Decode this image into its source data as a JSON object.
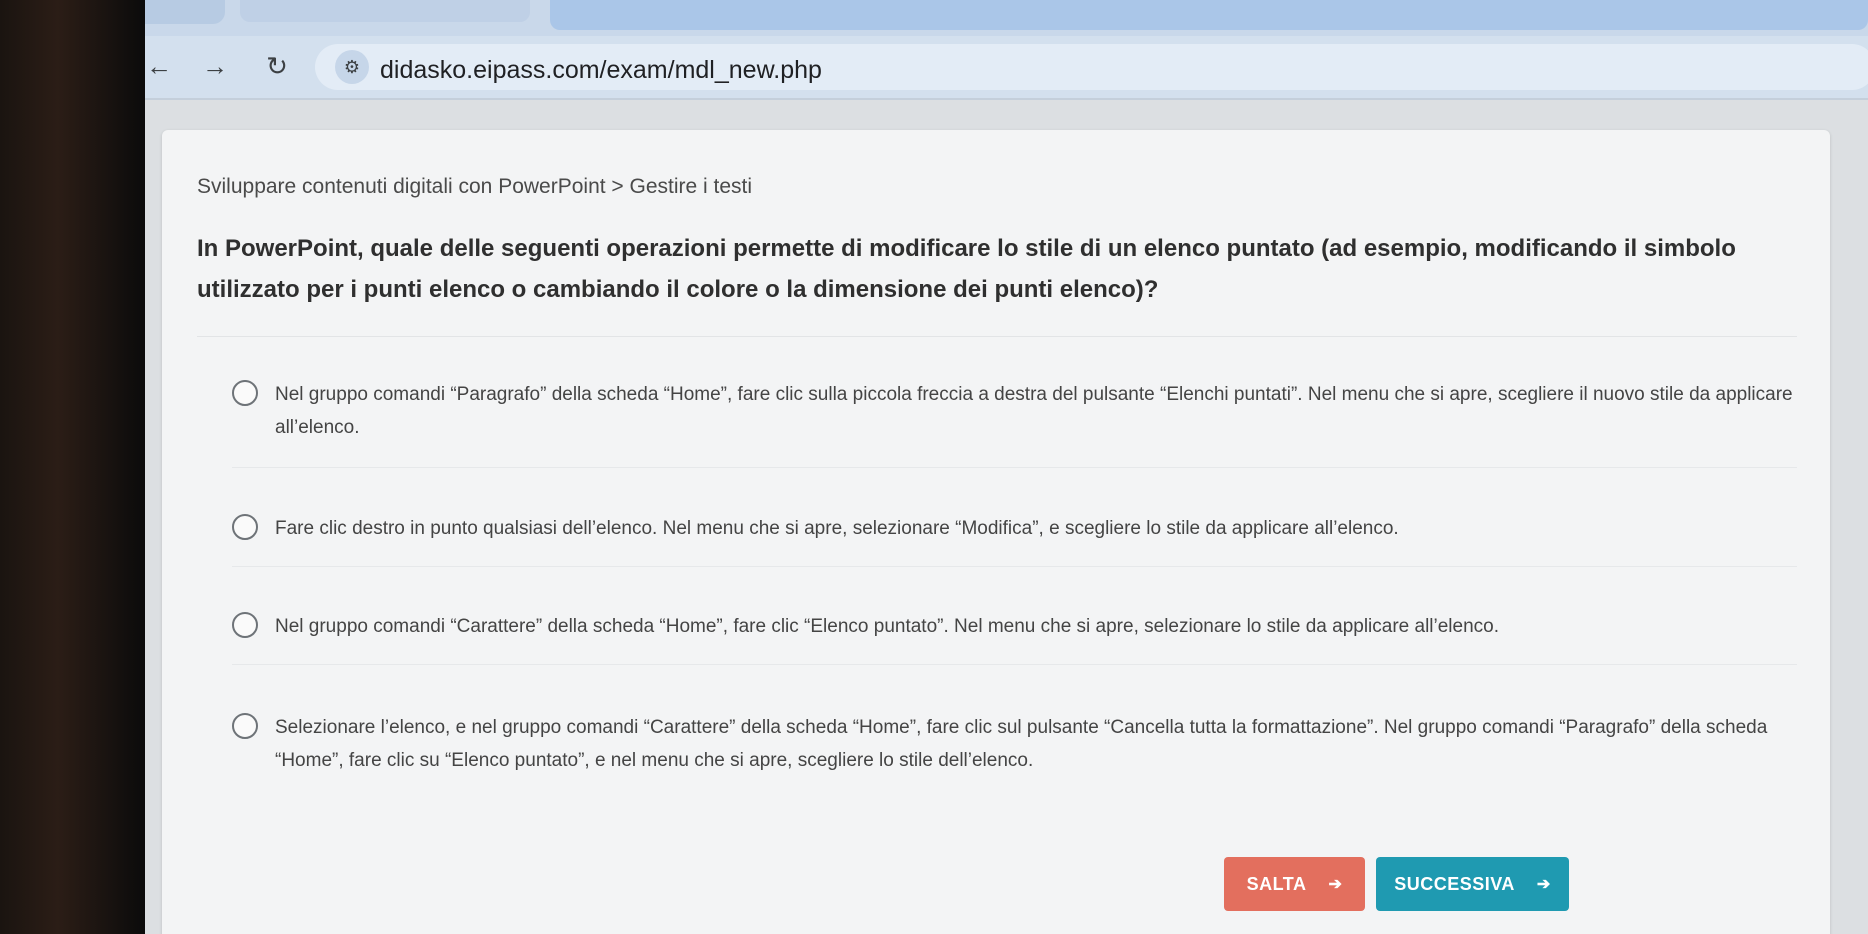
{
  "browser": {
    "url": "didasko.eipass.com/exam/mdl_new.php",
    "back_icon": "←",
    "forward_icon": "→",
    "reload_icon": "↻",
    "site_info_icon": "⚙"
  },
  "exam": {
    "breadcrumb": "Sviluppare contenuti digitali con PowerPoint > Gestire i testi",
    "question": "In PowerPoint, quale delle seguenti operazioni permette di modificare lo stile di un elenco puntato (ad esempio, modificando il simbolo utilizzato per i punti elenco o cambiando il colore o la dimensione dei punti elenco)?",
    "options": [
      {
        "label": "Nel gruppo comandi “Paragrafo” della scheda “Home”, fare clic sulla piccola freccia a destra del pulsante “Elenchi puntati”. Nel menu che si apre, scegliere il nuovo stile da applicare all’elenco."
      },
      {
        "label": "Fare clic destro in punto qualsiasi dell’elenco. Nel menu che si apre, selezionare “Modifica”, e scegliere lo stile da applicare all’elenco."
      },
      {
        "label": "Nel gruppo comandi “Carattere” della scheda “Home”, fare clic “Elenco puntato”. Nel menu che si apre, selezionare lo stile da applicare all’elenco."
      },
      {
        "label": "Selezionare l’elenco, e nel gruppo comandi “Carattere” della scheda “Home”, fare clic sul pulsante “Cancella tutta la formattazione”. Nel gruppo comandi “Paragrafo” della scheda “Home”, fare clic su “Elenco puntato”, e nel menu che si apre, scegliere lo stile dell’elenco."
      }
    ],
    "buttons": {
      "skip_label": "SALTA",
      "next_label": "SUCCESSIVA",
      "arrow_icon": "➔"
    }
  },
  "colors": {
    "skip": "#e36f5e",
    "next": "#1f9ab1"
  }
}
